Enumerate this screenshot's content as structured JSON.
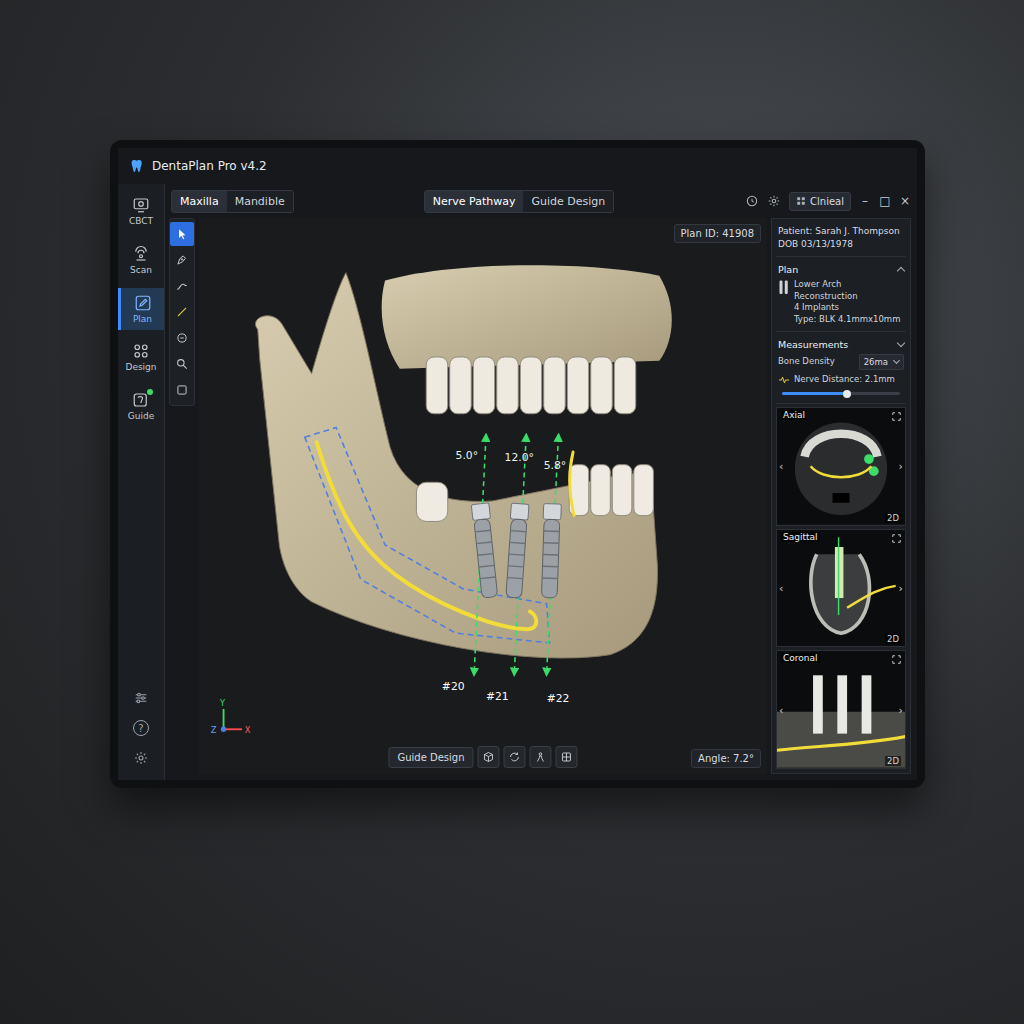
{
  "window": {
    "title": "DentaPlan Pro v4.2"
  },
  "nav": [
    {
      "label": "CBCT",
      "selected": false,
      "badge": false
    },
    {
      "label": "Scan",
      "selected": false,
      "badge": false
    },
    {
      "label": "Plan",
      "selected": true,
      "badge": false
    },
    {
      "label": "Design",
      "selected": false,
      "badge": false
    },
    {
      "label": "Guide",
      "selected": false,
      "badge": true
    }
  ],
  "sidebar_help": "?",
  "tools": [
    {
      "kind": "select",
      "selected": true
    },
    {
      "kind": "pen",
      "selected": false
    },
    {
      "kind": "draw",
      "selected": false
    },
    {
      "kind": "measure",
      "selected": false
    },
    {
      "kind": "angle",
      "selected": false
    },
    {
      "kind": "zoom",
      "selected": false
    },
    {
      "kind": "box",
      "selected": false
    }
  ],
  "arch_tabs": [
    {
      "label": "Maxilla",
      "selected": true
    },
    {
      "label": "Mandible",
      "selected": false
    }
  ],
  "view_tabs": [
    {
      "label": "Nerve Pathway",
      "selected": true
    },
    {
      "label": "Guide Design",
      "selected": false
    }
  ],
  "mode_button": "Clnieal",
  "window_controls": [
    "–",
    "□",
    "×"
  ],
  "plan_id": "Plan ID: 41908",
  "patient": {
    "name": "Patient: Sarah J. Thompson",
    "dob": "DOB 03/13/1978"
  },
  "plan": {
    "heading": "Plan",
    "lines": [
      "Lower Arch Reconstruction",
      "4 Implants",
      "Type: BLK 4.1mmx10mm"
    ]
  },
  "measurements": {
    "heading": "Measurements",
    "bone_density": {
      "label": "Bone Density",
      "value": "26ma"
    },
    "nerve_distance": {
      "label": "Nerve Distance: 2.1mm",
      "level": 0.55
    }
  },
  "views": [
    {
      "label": "Axial",
      "mode": "2D"
    },
    {
      "label": "Sagittal",
      "mode": "2D"
    },
    {
      "label": "Coronal",
      "mode": "2D"
    }
  ],
  "view_arrows": [
    "‹",
    "›"
  ],
  "implants": [
    {
      "tooth": "#20",
      "angle": "5.0°"
    },
    {
      "tooth": "#21",
      "angle": "12.0°"
    },
    {
      "tooth": "#22",
      "angle": "5.8°"
    }
  ],
  "bottom_toolbar": {
    "button": "Guide Design"
  },
  "angle_readout": "Angle: 7.2°",
  "axes": [
    "Y",
    "Z",
    "X"
  ]
}
